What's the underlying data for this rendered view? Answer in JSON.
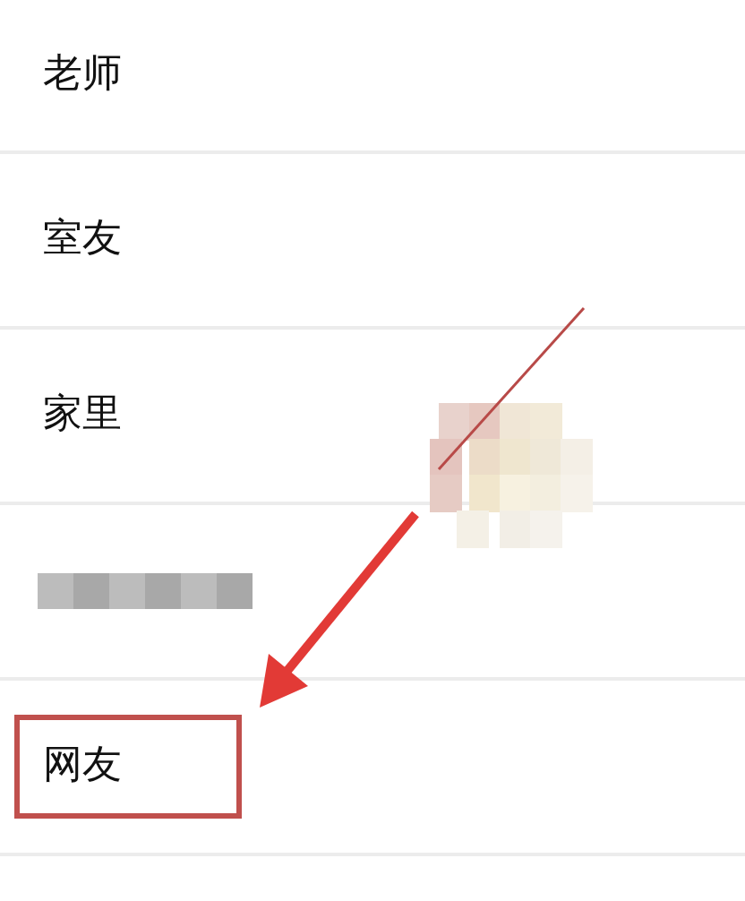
{
  "items": [
    {
      "kind": "text",
      "label": "老师",
      "highlighted": false
    },
    {
      "kind": "text",
      "label": "室友",
      "highlighted": false
    },
    {
      "kind": "text",
      "label": "家里",
      "highlighted": false
    },
    {
      "kind": "blurred",
      "highlighted": false
    },
    {
      "kind": "text",
      "label": "网友",
      "highlighted": true
    }
  ]
}
